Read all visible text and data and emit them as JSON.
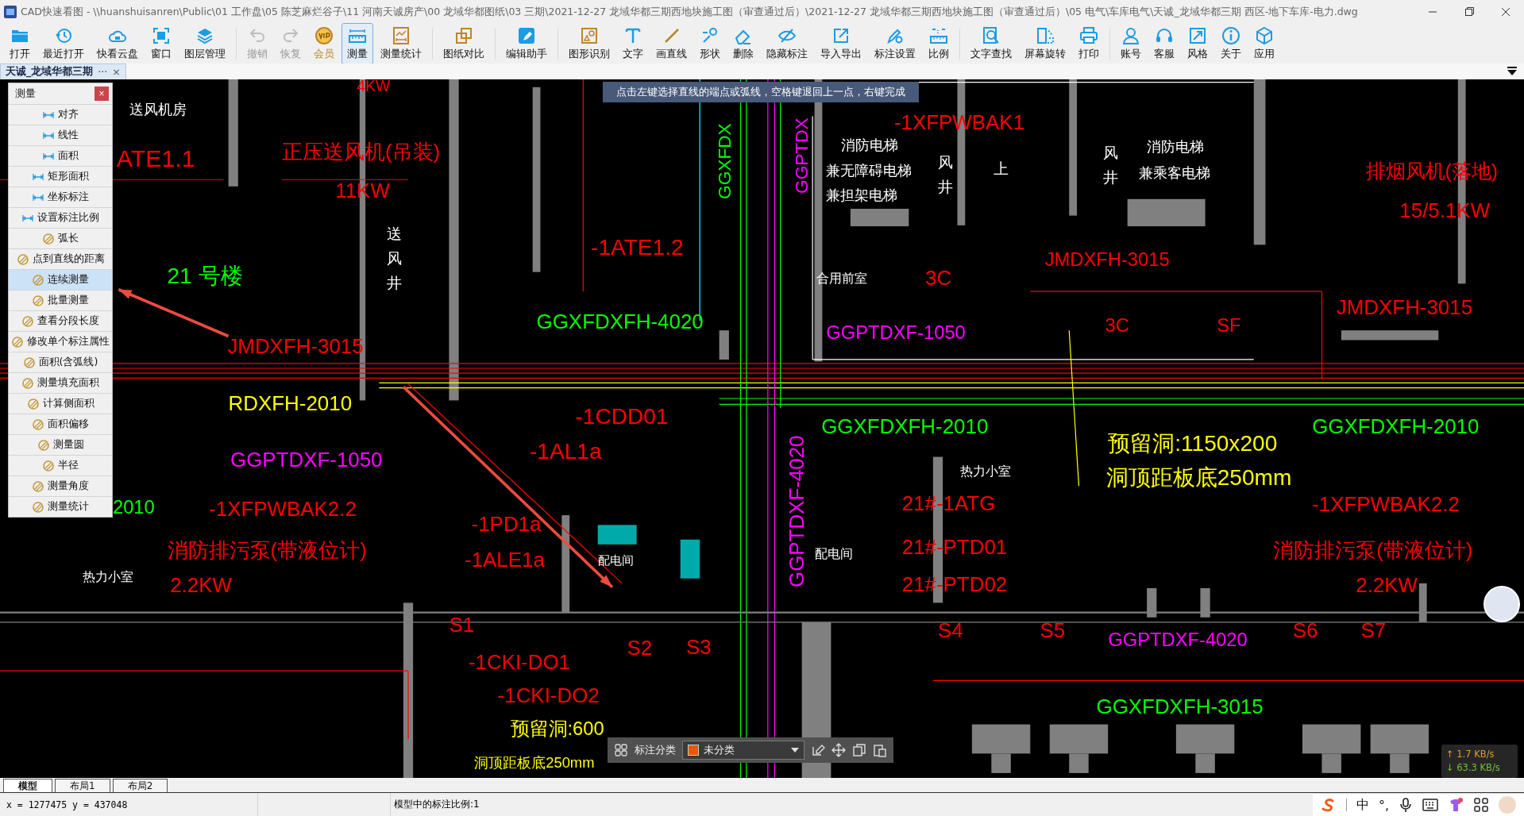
{
  "window": {
    "title": "CAD快速看图 - \\\\huanshuisanren\\Public\\01 工作盘\\05 陈芝麻烂谷子\\11 河南天诚房产\\00 龙域华都图纸\\03 三期\\2021-12-27 龙域华都三期西地块施工图（审查通过后）\\2021-12-27 龙域华都三期西地块施工图（审查通过后）\\05 电气\\车库电气\\天诚_龙域华都三期 西区-地下车库-电力.dwg"
  },
  "toolbar_groups": [
    [
      {
        "label": "打开",
        "disabled": false,
        "selected": false
      },
      {
        "label": "最近打开",
        "disabled": false,
        "selected": false
      },
      {
        "label": "快看云盘",
        "disabled": false,
        "selected": false
      },
      {
        "label": "窗口",
        "disabled": false,
        "selected": false
      },
      {
        "label": "图层管理",
        "disabled": false,
        "selected": false
      }
    ],
    [
      {
        "label": "撤销",
        "disabled": true,
        "selected": false
      },
      {
        "label": "恢复",
        "disabled": true,
        "selected": false
      },
      {
        "label": "会员",
        "disabled": false,
        "selected": false
      },
      {
        "label": "测量",
        "disabled": false,
        "selected": true
      },
      {
        "label": "测量统计",
        "disabled": false,
        "selected": false
      }
    ],
    [
      {
        "label": "图纸对比",
        "disabled": false,
        "selected": false
      }
    ],
    [
      {
        "label": "编辑助手",
        "disabled": false,
        "selected": false
      }
    ],
    [
      {
        "label": "图形识别",
        "disabled": false,
        "selected": false
      },
      {
        "label": "文字",
        "disabled": false,
        "selected": false
      },
      {
        "label": "画直线",
        "disabled": false,
        "selected": false
      },
      {
        "label": "形状",
        "disabled": false,
        "selected": false
      },
      {
        "label": "删除",
        "disabled": false,
        "selected": false
      },
      {
        "label": "隐藏标注",
        "disabled": false,
        "selected": false
      },
      {
        "label": "导入导出",
        "disabled": false,
        "selected": false
      },
      {
        "label": "标注设置",
        "disabled": false,
        "selected": false
      },
      {
        "label": "比例",
        "disabled": false,
        "selected": false
      }
    ],
    [
      {
        "label": "文字查找",
        "disabled": false,
        "selected": false
      },
      {
        "label": "屏幕旋转",
        "disabled": false,
        "selected": false
      },
      {
        "label": "打印",
        "disabled": false,
        "selected": false
      }
    ],
    [
      {
        "label": "账号",
        "disabled": false,
        "selected": false
      },
      {
        "label": "客服",
        "disabled": false,
        "selected": false
      },
      {
        "label": "风格",
        "disabled": false,
        "selected": false
      },
      {
        "label": "关于",
        "disabled": false,
        "selected": false
      },
      {
        "label": "应用",
        "disabled": false,
        "selected": false
      }
    ]
  ],
  "document_tabs": [
    {
      "label": "天诚_龙域华都三期",
      "more": "···",
      "close": "×",
      "selected": true
    }
  ],
  "hint": "点击左键选择直线的端点或弧线，空格键退回上一点，右键完成",
  "measure_panel": {
    "title": "测量",
    "close": "×",
    "items": [
      {
        "label": "对齐",
        "selected": false
      },
      {
        "label": "线性",
        "selected": false
      },
      {
        "label": "面积",
        "selected": false
      },
      {
        "label": "矩形面积",
        "selected": false
      },
      {
        "label": "坐标标注",
        "selected": false
      },
      {
        "label": "设置标注比例",
        "selected": false
      },
      {
        "label": "弧长",
        "selected": false
      },
      {
        "label": "点到直线的距离",
        "selected": false
      },
      {
        "label": "连续测量",
        "selected": true
      },
      {
        "label": "批量测量",
        "selected": false
      },
      {
        "label": "查看分段长度",
        "selected": false
      },
      {
        "label": "修改单个标注属性",
        "selected": false
      },
      {
        "label": "面积(含弧线)",
        "selected": false
      },
      {
        "label": "测量填充面积",
        "selected": false
      },
      {
        "label": "计算侧面积",
        "selected": false
      },
      {
        "label": "面积偏移",
        "selected": false
      },
      {
        "label": "测量圆",
        "selected": false
      },
      {
        "label": "半径",
        "selected": false
      },
      {
        "label": "测量角度",
        "selected": false
      },
      {
        "label": "测量统计",
        "selected": false
      }
    ]
  },
  "drawing_labels": [
    {
      "text": "4KW",
      "color": "#ff0000",
      "kind": "text"
    },
    {
      "text": "送风机房",
      "color": "#ffffff",
      "kind": "text"
    },
    {
      "text": "ATE1.1",
      "color": "#ff0000",
      "kind": "text"
    },
    {
      "text": "正压送风机(吊装)",
      "color": "#ff0000",
      "kind": "text"
    },
    {
      "text": "11KW",
      "color": "#ff0000",
      "kind": "text"
    },
    {
      "text": "21 号楼",
      "color": "#00ff00",
      "kind": "text"
    },
    {
      "text": "送风井",
      "color": "#ffffff",
      "kind": "vertical"
    },
    {
      "text": "-1ATE1.2",
      "color": "#ff0000",
      "kind": "text"
    },
    {
      "text": "GGXFDXFH-4020",
      "color": "#00ff00",
      "kind": "text"
    },
    {
      "text": "JMDXFH-3015",
      "color": "#ff0000",
      "kind": "text"
    },
    {
      "text": "RDXFH-2010",
      "color": "#ffff00",
      "kind": "text"
    },
    {
      "text": "GGPTDXF-1050",
      "color": "#ff00ff",
      "kind": "text"
    },
    {
      "text": "-1CDD01",
      "color": "#ff0000",
      "kind": "text"
    },
    {
      "text": "-1AL1a",
      "color": "#ff0000",
      "kind": "text"
    },
    {
      "text": "2010",
      "color": "#00ff00",
      "kind": "text"
    },
    {
      "text": "-1XFPWBAK2.2",
      "color": "#ff0000",
      "kind": "text"
    },
    {
      "text": "-1PD1a",
      "color": "#ff0000",
      "kind": "text"
    },
    {
      "text": "消防排污泵(带液位计)",
      "color": "#ff0000",
      "kind": "text"
    },
    {
      "text": "-1ALE1a",
      "color": "#ff0000",
      "kind": "text"
    },
    {
      "text": "热力小室",
      "color": "#ffffff",
      "kind": "text"
    },
    {
      "text": "2.2KW",
      "color": "#ff0000",
      "kind": "text"
    },
    {
      "text": "配电间",
      "color": "#ffffff",
      "kind": "text"
    },
    {
      "text": "S1",
      "color": "#ff0000",
      "kind": "text"
    },
    {
      "text": "S2",
      "color": "#ff0000",
      "kind": "text"
    },
    {
      "text": "S3",
      "color": "#ff0000",
      "kind": "text"
    },
    {
      "text": "-1CKI-DO1",
      "color": "#ff0000",
      "kind": "text"
    },
    {
      "text": "-1CKI-DO2",
      "color": "#ff0000",
      "kind": "text"
    },
    {
      "text": "预留洞:600",
      "color": "#ffff00",
      "kind": "text"
    },
    {
      "text": "洞顶距板底250mm",
      "color": "#ffff00",
      "kind": "text"
    },
    {
      "text": "GGXFDX",
      "color": "#00ff00",
      "kind": "rotated"
    },
    {
      "text": "GGPTDX",
      "color": "#ff00ff",
      "kind": "rotated"
    },
    {
      "text": "-1XFPWBAK1",
      "color": "#ff0000",
      "kind": "text"
    },
    {
      "text": "消防电梯",
      "color": "#ffffff",
      "kind": "text"
    },
    {
      "text": "兼无障碍电梯",
      "color": "#ffffff",
      "kind": "text"
    },
    {
      "text": "兼担架电梯",
      "color": "#ffffff",
      "kind": "text"
    },
    {
      "text": "风井",
      "color": "#ffffff",
      "kind": "vertical"
    },
    {
      "text": "上",
      "color": "#ffffff",
      "kind": "text"
    },
    {
      "text": "风井",
      "color": "#ffffff",
      "kind": "vertical"
    },
    {
      "text": "消防电梯",
      "color": "#ffffff",
      "kind": "text"
    },
    {
      "text": "兼乘客电梯",
      "color": "#ffffff",
      "kind": "text"
    },
    {
      "text": "排烟风机(落地)",
      "color": "#ff0000",
      "kind": "text"
    },
    {
      "text": "15/5.1KW",
      "color": "#ff0000",
      "kind": "text"
    },
    {
      "text": "合用前室",
      "color": "#ffffff",
      "kind": "text"
    },
    {
      "text": "3C",
      "color": "#ff0000",
      "kind": "text"
    },
    {
      "text": "JMDXFH-3015",
      "color": "#ff0000",
      "kind": "text"
    },
    {
      "text": "JMDXFH-3015",
      "color": "#ff0000",
      "kind": "text"
    },
    {
      "text": "3C",
      "color": "#ff0000",
      "kind": "text"
    },
    {
      "text": "SF",
      "color": "#ff0000",
      "kind": "text"
    },
    {
      "text": "GGPTDXF-1050",
      "color": "#ff00ff",
      "kind": "text"
    },
    {
      "text": "GGXFDXFH-2010",
      "color": "#00ff00",
      "kind": "text"
    },
    {
      "text": "GGXFDXFH-2010",
      "color": "#00ff00",
      "kind": "text"
    },
    {
      "text": "预留洞:1150x200",
      "color": "#ffff00",
      "kind": "text"
    },
    {
      "text": "热力小室",
      "color": "#ffffff",
      "kind": "text"
    },
    {
      "text": "洞顶距板底250mm",
      "color": "#ffff00",
      "kind": "text"
    },
    {
      "text": "GGPTDXF-4020",
      "color": "#ff00ff",
      "kind": "rotated"
    },
    {
      "text": "21#-1ATG",
      "color": "#ff0000",
      "kind": "text"
    },
    {
      "text": "配电间",
      "color": "#ffffff",
      "kind": "text"
    },
    {
      "text": "21#-PTD01",
      "color": "#ff0000",
      "kind": "text"
    },
    {
      "text": "21#-PTD02",
      "color": "#ff0000",
      "kind": "text"
    },
    {
      "text": "-1XFPWBAK2.2",
      "color": "#ff0000",
      "kind": "text"
    },
    {
      "text": "消防排污泵(带液位计)",
      "color": "#ff0000",
      "kind": "text"
    },
    {
      "text": "2.2KW",
      "color": "#ff0000",
      "kind": "text"
    },
    {
      "text": "S4",
      "color": "#ff0000",
      "kind": "text"
    },
    {
      "text": "S5",
      "color": "#ff0000",
      "kind": "text"
    },
    {
      "text": "GGPTDXF-4020",
      "color": "#ff00ff",
      "kind": "text"
    },
    {
      "text": "S6",
      "color": "#ff0000",
      "kind": "text"
    },
    {
      "text": "S7",
      "color": "#ff0000",
      "kind": "text"
    },
    {
      "text": "GGXFDXFH-3015",
      "color": "#00ff00",
      "kind": "text"
    }
  ],
  "annotation_bar": {
    "label": "标注分类",
    "category": {
      "label": "未分类",
      "color": "#e8560a"
    }
  },
  "network_speed": {
    "upload": "↑ 1.7 KB/s",
    "download": "↓ 63.3 KB/s"
  },
  "layout_tabs": [
    {
      "label": "模型",
      "selected": true
    },
    {
      "label": "布局1",
      "selected": false
    },
    {
      "label": "布局2",
      "selected": false
    }
  ],
  "status_bar": {
    "coordinates": "x = 1277475 y = 437048",
    "scale": "模型中的标注比例:1"
  },
  "tray": {
    "input_method": "中",
    "punctuation": "°,"
  }
}
